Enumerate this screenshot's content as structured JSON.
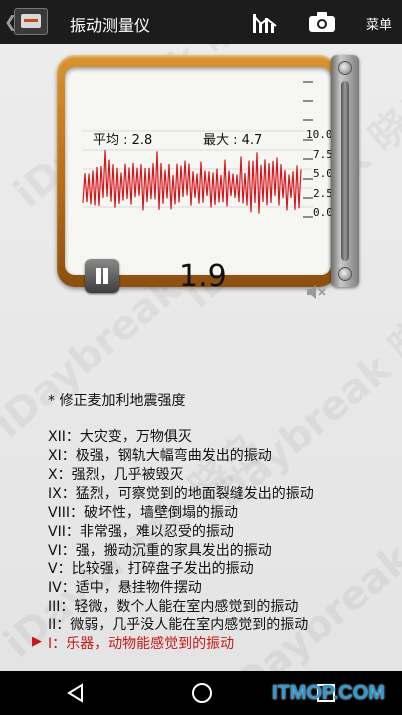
{
  "app_bar": {
    "title": "振动测量仪",
    "menu_label": "菜单",
    "icons": [
      "back-chevron-icon",
      "app-logo-icon",
      "chart-icon",
      "camera-icon"
    ]
  },
  "meter": {
    "average_label": "平均 : 2.8",
    "max_label": "最大 : 4.7",
    "scale_labels": [
      "10.0",
      "7.5",
      "5.0",
      "2.5",
      "0.0"
    ],
    "current_reading": "1.9",
    "colors": {
      "frame": "#c07a1e",
      "wave": "#d6181e",
      "screen": "#f6f6f2"
    },
    "icons": [
      "pause-icon",
      "mute-speaker-icon"
    ]
  },
  "intensity": {
    "heading": "* 修正麦加利地震强度",
    "levels": [
      "XII：大灾变，万物俱灭",
      "XI：极强，钢轨大幅弯曲发出的振动",
      "X：强烈，几乎被毁灭",
      "IX：猛烈，可察觉到的地面裂缝发出的振动",
      "VIII：破坏性，墙壁倒塌的振动",
      "VII：非常强，难以忍受的振动",
      "VI：强，搬动沉重的家具发出的振动",
      "V：比较强，打碎盘子发出的振动",
      "IV：适中，悬挂物件摆动",
      "III：轻微，数个人能在室内感觉到的振动",
      "II：微弱，几乎没人能在室内感觉到的振动",
      "I：乐器，动物能感觉到的振动"
    ],
    "active_marker": "▶",
    "active_color": "#c81616"
  },
  "watermark": {
    "text": "iDaybreak 晓岛"
  },
  "nav": {
    "site_label": "ITMOP.COM",
    "icons": [
      "nav-back-icon",
      "nav-home-icon",
      "nav-recent-icon"
    ]
  }
}
